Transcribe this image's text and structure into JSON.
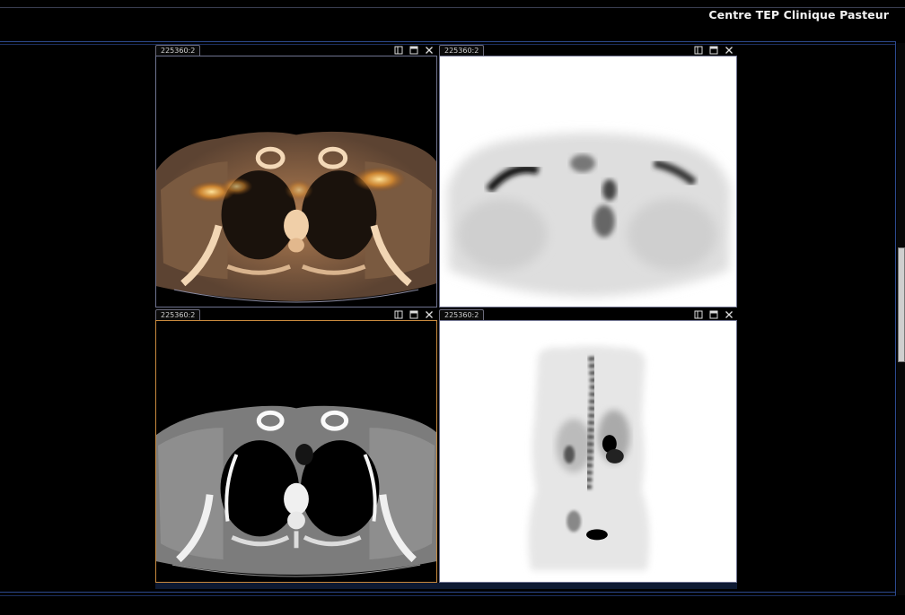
{
  "app": {
    "title": "Centre TEP Clinique Pasteur"
  },
  "viewports": [
    {
      "id": "fusion-axial",
      "label": "225360:2",
      "active": false
    },
    {
      "id": "pet-axial",
      "label": "225360:2",
      "active": false
    },
    {
      "id": "ct-axial",
      "label": "225360:2",
      "active": true
    },
    {
      "id": "pet-mip",
      "label": "225360:2",
      "active": false
    }
  ],
  "icons": {
    "layout": "layout-icon",
    "maximize": "maximize-icon",
    "close": "close-icon"
  },
  "colors": {
    "frame": "#2d4a8f",
    "active_viewport_border": "#c98a3e",
    "viewport_border": "#6f7390"
  }
}
